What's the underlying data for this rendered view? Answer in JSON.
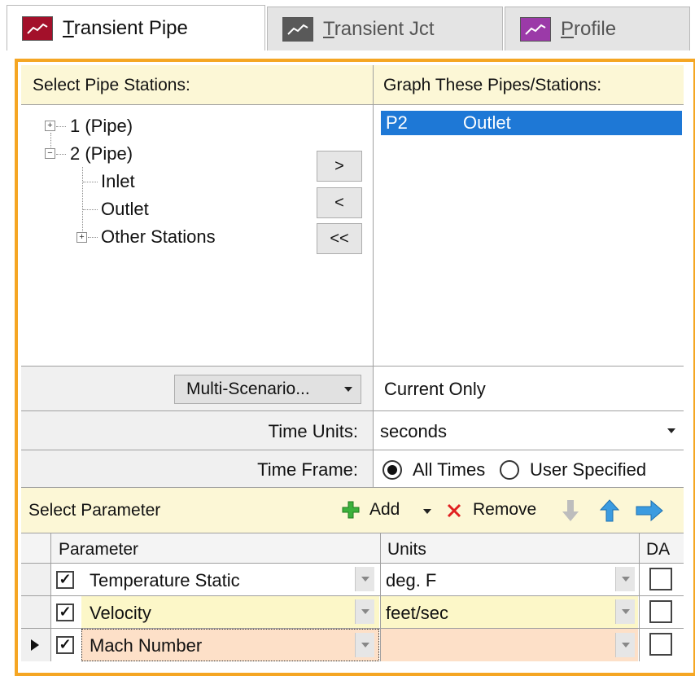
{
  "tabs": [
    {
      "label_first": "T",
      "label_rest": "ransient Pipe",
      "icon": "chart-line-icon",
      "color": "#a3102a"
    },
    {
      "label_first": "T",
      "label_rest": "ransient Jct",
      "icon": "chart-line-icon",
      "color": "#595959"
    },
    {
      "label_first": "P",
      "label_rest": "rofile",
      "icon": "chart-line-icon",
      "color": "#9b3aa8"
    }
  ],
  "stations_header": "Select Pipe Stations:",
  "graph_header": "Graph These Pipes/Stations:",
  "tree": {
    "pipe1": "1 (Pipe)",
    "pipe2": "2 (Pipe)",
    "inlet": "Inlet",
    "outlet": "Outlet",
    "other": "Other Stations"
  },
  "move_buttons": {
    "add": ">",
    "remove": "<",
    "remove_all": "<<"
  },
  "graph_list": [
    {
      "pipe": "P2",
      "station": "Outlet"
    }
  ],
  "scenario_button": "Multi-Scenario...",
  "scenario_value": "Current Only",
  "time_units_label": "Time Units:",
  "time_units_value": "seconds",
  "time_frame_label": "Time Frame:",
  "time_frame_options": {
    "all": "All Times",
    "user": "User Specified",
    "selected": "all"
  },
  "param_toolbar": {
    "title": "Select Parameter",
    "add": "Add",
    "remove": "Remove"
  },
  "param_table": {
    "headers": {
      "parameter": "Parameter",
      "units": "Units",
      "da": "DA"
    },
    "rows": [
      {
        "parameter": "Temperature Static",
        "units": "deg. F",
        "checked": true,
        "da": false,
        "bg": "#ffffff"
      },
      {
        "parameter": "Velocity",
        "units": "feet/sec",
        "checked": true,
        "da": false,
        "bg": "#fcf7c8"
      },
      {
        "parameter": "Mach Number",
        "units": "",
        "checked": true,
        "da": false,
        "bg": "#fde0c8"
      }
    ]
  },
  "colors": {
    "accent_border": "#f5a623",
    "selection": "#1e78d6",
    "header_yellow": "#fcf7d6"
  }
}
